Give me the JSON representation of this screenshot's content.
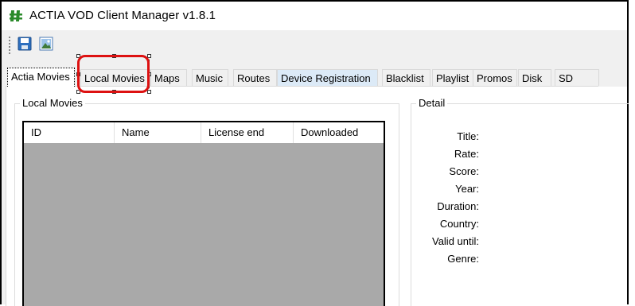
{
  "window": {
    "title": "ACTIA VOD Client Manager v1.8.1"
  },
  "toolbar": {
    "buttons": [
      "save-icon",
      "image-icon"
    ]
  },
  "tabs": [
    {
      "label": "Actia Movies"
    },
    {
      "label": "Local Movies"
    },
    {
      "label": "Maps"
    },
    {
      "label": "Music"
    },
    {
      "label": "Routes"
    },
    {
      "label": "Device Registration"
    },
    {
      "label": "Blacklist"
    },
    {
      "label": "Playlist"
    },
    {
      "label": "Promos"
    },
    {
      "label": "Disk"
    },
    {
      "label": "SD"
    }
  ],
  "local_movies": {
    "group_title": "Local Movies",
    "columns": [
      "ID",
      "Name",
      "License end",
      "Downloaded"
    ],
    "rows": []
  },
  "detail": {
    "group_title": "Detail",
    "fields": [
      "Title:",
      "Rate:",
      "Score:",
      "Year:",
      "Duration:",
      "Country:",
      "Valid until:",
      "Genre:"
    ]
  },
  "colors": {
    "highlight": "#dd1111",
    "app_icon": "#2a8a2a",
    "list_bg": "#a9a9a9"
  }
}
